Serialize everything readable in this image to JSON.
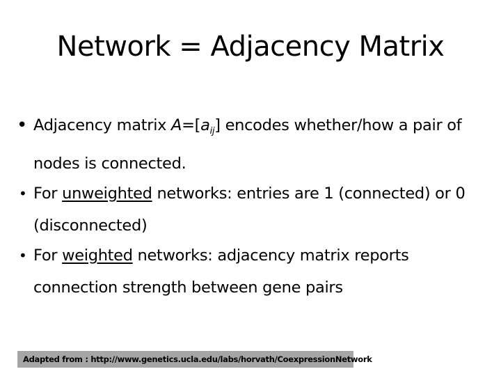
{
  "slide": {
    "title": "Network = Adjacency Matrix",
    "bullets": [
      {
        "marker": "•",
        "pre": "Adjacency matrix ",
        "var_A": "A",
        "eq_open": "=[",
        "var_a": "a",
        "sub": "ij",
        "post": "] encodes whether/how a pair of nodes is connected."
      },
      {
        "marker": "•",
        "pre": "For ",
        "underlined": "unweighted",
        "post": " networks: entries are 1 (connected) or 0 (disconnected)"
      },
      {
        "marker": "•",
        "pre": "For ",
        "underlined": "weighted",
        "post": " networks: adjacency matrix reports connection strength between gene pairs"
      }
    ],
    "footer": "Adapted from : http://www.genetics.ucla.edu/labs/horvath/CoexpressionNetwork"
  }
}
